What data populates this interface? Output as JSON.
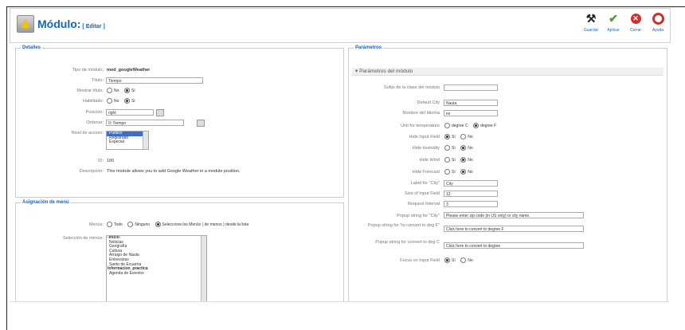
{
  "header": {
    "title": "Módulo:",
    "subtitle": "[ Editar ]",
    "toolbar": [
      {
        "icon": "save-icon",
        "label": "Guardar"
      },
      {
        "icon": "apply-icon",
        "label": "Aplicar"
      },
      {
        "icon": "close-icon",
        "label": "Cerrar"
      },
      {
        "icon": "help-icon",
        "label": "Ayuda"
      }
    ]
  },
  "details": {
    "legend": "Detalles",
    "module_type_label": "Tipo de módulo:",
    "module_type_value": "mod_googleWeather",
    "title_label": "Título:",
    "title_value": "Tiempo",
    "show_title_label": "Mostrar título:",
    "enabled_label": "Habilitado:",
    "no": "No",
    "si": "Sí",
    "position_label": "Posición:",
    "position_value": "right",
    "order_label": "Ordenar:",
    "order_value": "0::Tiempo",
    "access_label": "Nivel de acceso:",
    "access_options": [
      "Público",
      "Registrado",
      "Especial"
    ],
    "id_label": "ID:",
    "id_value": "100",
    "description_label": "Descripción:",
    "description_value": "This module allows you to add Google Weather in a module position."
  },
  "assignment": {
    "legend": "Asignación de menú",
    "menus_label": "Menús:",
    "opt_all": "Todo",
    "opt_none": "Ninguno",
    "opt_select": "Seleccione los Menús ( de menos ) desde la lista",
    "selection_label": "Selección de menús:",
    "menu_items": [
      {
        "text": "-Inicio-",
        "group": true
      },
      {
        "text": "Noticias",
        "group": false
      },
      {
        "text": "Geografía",
        "group": false
      },
      {
        "text": "Cultura",
        "group": false
      },
      {
        "text": "Arraigo de Nauta",
        "group": false
      },
      {
        "text": "Entrevistas",
        "group": false
      },
      {
        "text": "Santo de Ecuarría",
        "group": false
      },
      {
        "text": "Informacion_practica",
        "group": true
      },
      {
        "text": "Agenda de Eventos",
        "group": false
      }
    ]
  },
  "params": {
    "legend": "Parámetros",
    "section": "Parámetros del módulo",
    "rows": [
      {
        "label": "Sufijo de la clase del módulo",
        "type": "input",
        "value": ""
      },
      {
        "label": "Default City",
        "type": "input",
        "value": "Nauta"
      },
      {
        "label": "Nombre del Idioma",
        "type": "input",
        "value": "es"
      },
      {
        "label": "Unit for temperature",
        "type": "radio",
        "options": [
          "degree C",
          "degree F"
        ],
        "selected": 1
      },
      {
        "label": "Hide Input Field",
        "type": "radio",
        "options": [
          "Sí",
          "No"
        ],
        "selected": 0
      },
      {
        "label": "Hide Humidity",
        "type": "radio",
        "options": [
          "Sí",
          "No"
        ],
        "selected": 1
      },
      {
        "label": "Hide Wind",
        "type": "radio",
        "options": [
          "Sí",
          "No"
        ],
        "selected": 1
      },
      {
        "label": "Hide Forecast",
        "type": "radio",
        "options": [
          "Sí",
          "No"
        ],
        "selected": 1
      },
      {
        "label": "Label for \"City\"",
        "type": "input",
        "value": "City"
      },
      {
        "label": "Size of Input Field",
        "type": "input",
        "value": "12"
      },
      {
        "label": "Request Interval",
        "type": "input",
        "value": "3"
      },
      {
        "label": "Popup string for \"City\"",
        "type": "input",
        "value": "Please enter zip code (in US only) or city name."
      },
      {
        "label": "Popup string for \"to convert to deg F\"",
        "type": "input",
        "value": "Click here to convert to degree F"
      },
      {
        "label": "Popup string for convert to deg C",
        "type": "input",
        "value": "Click here to convert to degree"
      },
      {
        "label": "Focus on Input Field",
        "type": "radio",
        "options": [
          "Sí",
          "No"
        ],
        "selected": 0
      }
    ]
  }
}
